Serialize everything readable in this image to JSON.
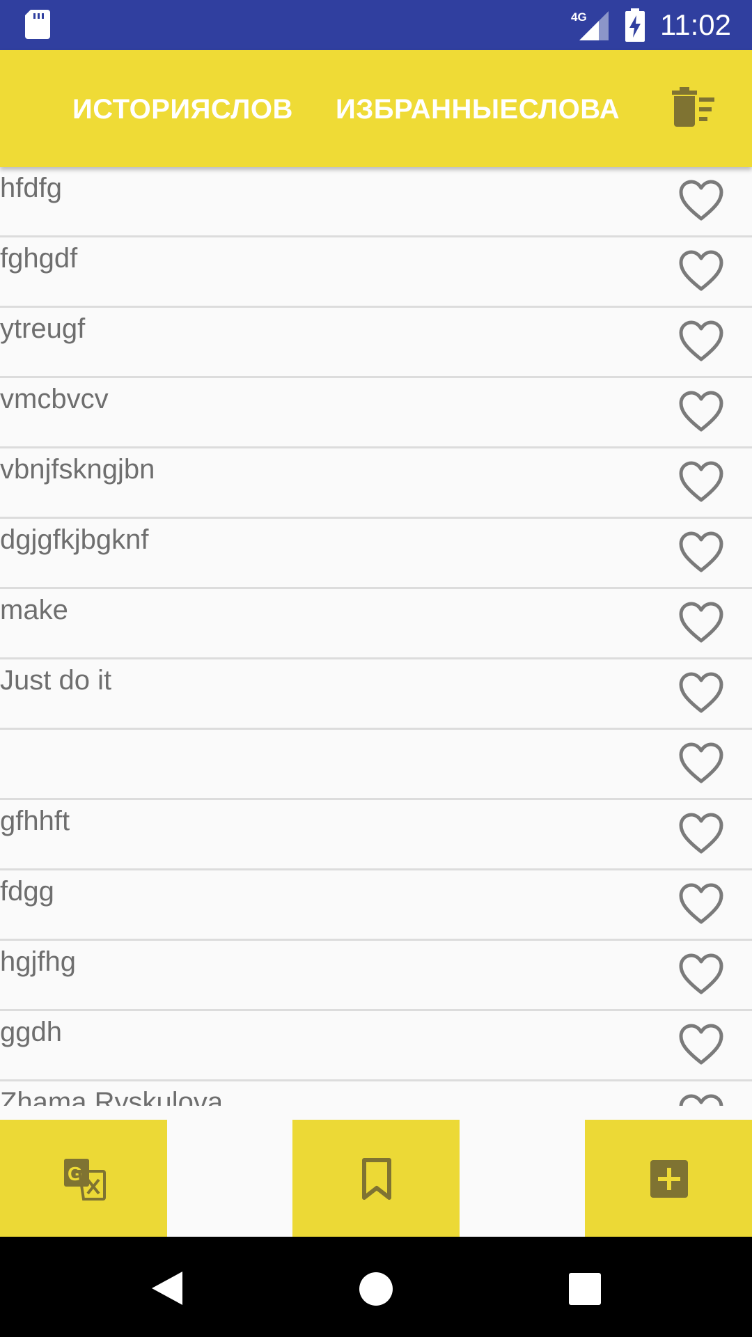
{
  "status_bar": {
    "network": "4G",
    "time": "11:02"
  },
  "toolbar": {
    "tab_history": "ИСТОРИЯСЛОВ",
    "tab_favorites": "ИЗБРАННЫЕСЛОВА",
    "delete_icon": "delete-sweep-icon"
  },
  "words": [
    {
      "text": "hfdfg",
      "favorite": false
    },
    {
      "text": "fghgdf",
      "favorite": false
    },
    {
      "text": "ytreugf",
      "favorite": false
    },
    {
      "text": "vmcbvcv",
      "favorite": false
    },
    {
      "text": "vbnjfskngjbn",
      "favorite": false
    },
    {
      "text": "dgjgfkjbgknf",
      "favorite": false
    },
    {
      "text": "make",
      "favorite": false
    },
    {
      "text": "Just do it",
      "favorite": false
    },
    {
      "text": "",
      "favorite": false
    },
    {
      "text": "gfhhft",
      "favorite": false
    },
    {
      "text": "fdgg",
      "favorite": false
    },
    {
      "text": "hgjfhg",
      "favorite": false
    },
    {
      "text": "ggdh",
      "favorite": false
    },
    {
      "text": "Zhama Ryskulova",
      "favorite": false
    }
  ],
  "bottom_bar": {
    "translate_icon": "google-translate-icon",
    "bookmark_icon": "bookmark-icon",
    "add_icon": "add-box-icon"
  },
  "nav_bar": {
    "back_icon": "back-triangle-icon",
    "home_icon": "home-circle-icon",
    "recents_icon": "recents-square-icon"
  },
  "colors": {
    "status_bar": "#303f9f",
    "accent_yellow": "#efdb36",
    "icon_dark": "#7f7332",
    "text_gray": "#6e6e6e"
  }
}
